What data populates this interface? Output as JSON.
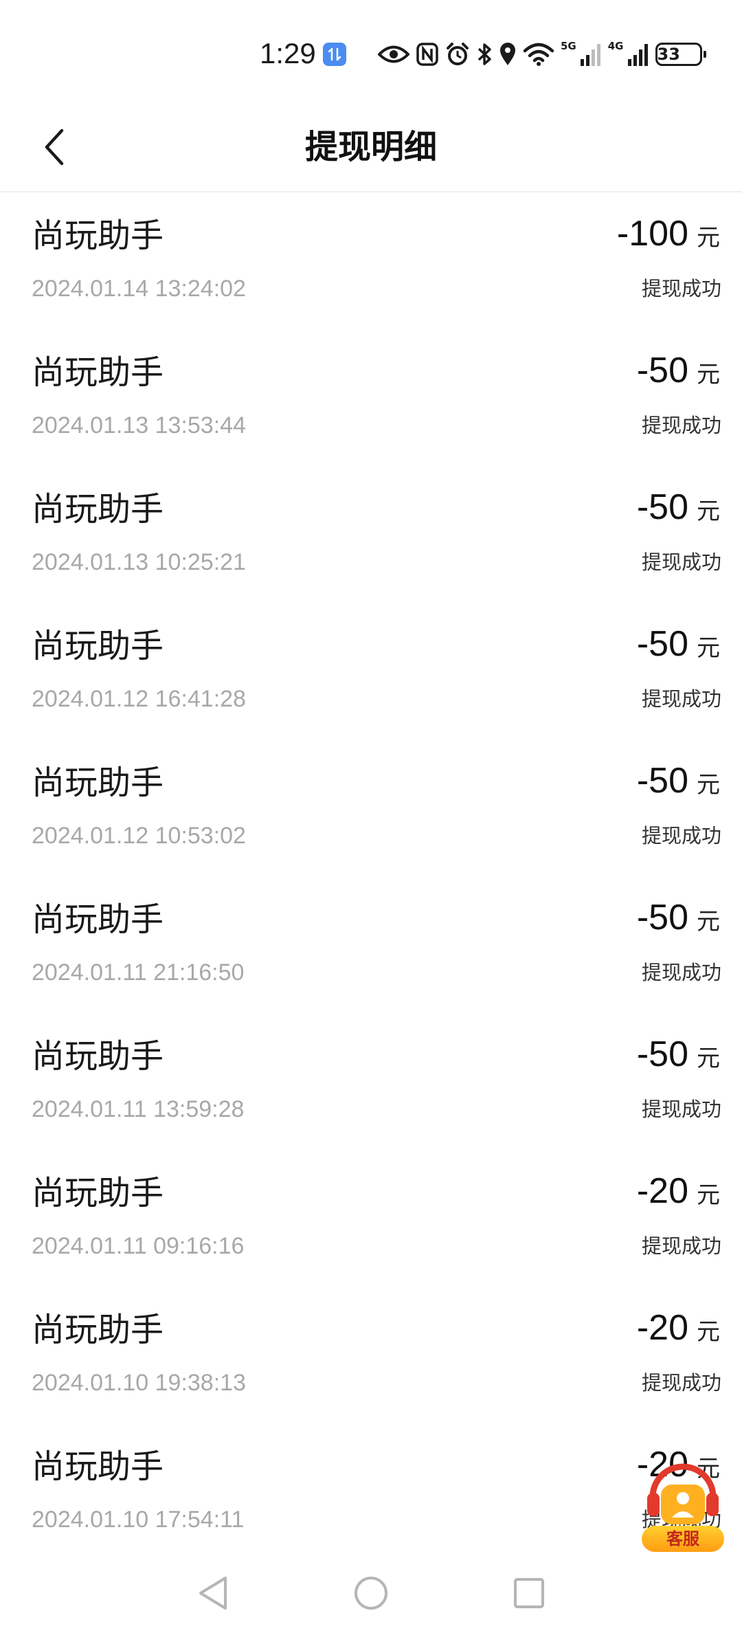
{
  "status_bar": {
    "time": "1:29",
    "net_5g": "5G",
    "net_4g": "4G",
    "battery": "33",
    "icons": [
      "data-sync-icon",
      "eye-icon",
      "nfc-icon",
      "alarm-icon",
      "bluetooth-icon",
      "location-icon",
      "wifi-icon",
      "signal-icon",
      "battery-icon"
    ]
  },
  "header": {
    "title": "提现明细",
    "back_icon": "chevron-left-icon"
  },
  "records": [
    {
      "name": "尚玩助手",
      "time": "2024.01.14 13:24:02",
      "amount": "-100",
      "unit": "元",
      "status": "提现成功"
    },
    {
      "name": "尚玩助手",
      "time": "2024.01.13 13:53:44",
      "amount": "-50",
      "unit": "元",
      "status": "提现成功"
    },
    {
      "name": "尚玩助手",
      "time": "2024.01.13 10:25:21",
      "amount": "-50",
      "unit": "元",
      "status": "提现成功"
    },
    {
      "name": "尚玩助手",
      "time": "2024.01.12 16:41:28",
      "amount": "-50",
      "unit": "元",
      "status": "提现成功"
    },
    {
      "name": "尚玩助手",
      "time": "2024.01.12 10:53:02",
      "amount": "-50",
      "unit": "元",
      "status": "提现成功"
    },
    {
      "name": "尚玩助手",
      "time": "2024.01.11 21:16:50",
      "amount": "-50",
      "unit": "元",
      "status": "提现成功"
    },
    {
      "name": "尚玩助手",
      "time": "2024.01.11 13:59:28",
      "amount": "-50",
      "unit": "元",
      "status": "提现成功"
    },
    {
      "name": "尚玩助手",
      "time": "2024.01.11 09:16:16",
      "amount": "-20",
      "unit": "元",
      "status": "提现成功"
    },
    {
      "name": "尚玩助手",
      "time": "2024.01.10 19:38:13",
      "amount": "-20",
      "unit": "元",
      "status": "提现成功"
    },
    {
      "name": "尚玩助手",
      "time": "2024.01.10 17:54:11",
      "amount": "-20",
      "unit": "元",
      "status": "提现成功"
    }
  ],
  "customer_service": {
    "label": "客服",
    "icon": "headset-agent-icon"
  },
  "nav_bar": {
    "icons": [
      "back-triangle-icon",
      "home-circle-icon",
      "recents-square-icon"
    ]
  },
  "colors": {
    "text_primary": "#111111",
    "text_secondary": "#a8a8a8",
    "sync_badge": "#4a8cf0",
    "cs_badge": "#ffb020",
    "cs_text": "#c2281b"
  }
}
